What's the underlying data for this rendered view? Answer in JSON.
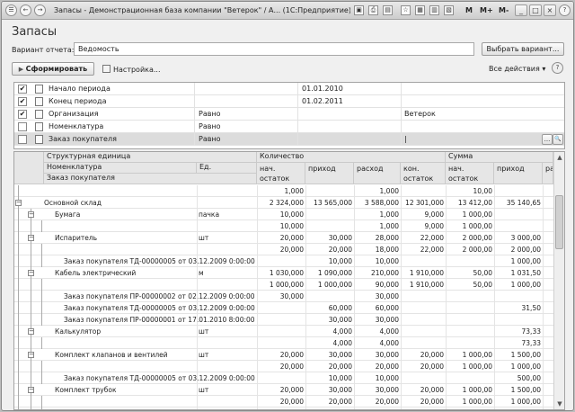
{
  "window": {
    "title": "Запасы - Демонстрационная база компании \"Ветерок\" / А...",
    "app": "(1С:Предприятие)",
    "m_labels": [
      "M",
      "M+",
      "M-"
    ],
    "controls": [
      "_",
      "□",
      "×"
    ],
    "star": "☆",
    "question": "?"
  },
  "heading": "Запасы",
  "variant": {
    "label": "Вариант отчета:",
    "value": "Ведомость",
    "button": "Выбрать вариант..."
  },
  "toolbar": {
    "form_button": "Сформировать",
    "settings_button": "Настройка...",
    "all_actions": "Все действия ▾",
    "help": "?"
  },
  "filters": [
    {
      "checked": true,
      "name": "Начало периода",
      "compare": "",
      "value": "01.01.2010",
      "value2": ""
    },
    {
      "checked": true,
      "name": "Конец периода",
      "compare": "",
      "value": "01.02.2011",
      "value2": ""
    },
    {
      "checked": true,
      "name": "Организация",
      "compare": "Равно",
      "value": "",
      "value2": "Ветерок"
    },
    {
      "checked": false,
      "name": "Номенклатура",
      "compare": "Равно",
      "value": "",
      "value2": ""
    },
    {
      "checked": false,
      "name": "Заказ покупателя",
      "compare": "Равно",
      "value": "",
      "value2": "|"
    }
  ],
  "filter_buttons": [
    "...",
    "🔍"
  ],
  "grid": {
    "headers": {
      "structure": "Структурная единица",
      "nomenclature": "Номенклатура",
      "order": "Заказ покупателя",
      "unit": "Ед.",
      "quantity": "Количество",
      "sum": "Сумма",
      "cols": [
        "нач. остаток",
        "приход",
        "расход",
        "кон. остаток",
        "нач. остаток",
        "приход",
        "ра"
      ]
    },
    "rows": [
      {
        "level": 0,
        "name": "",
        "unit": "",
        "vals": [
          "1,000",
          "",
          "1,000",
          "",
          "10,00",
          "",
          ""
        ]
      },
      {
        "level": 0,
        "name": "Основной склад",
        "unit": "",
        "vals": [
          "2 324,000",
          "13 565,000",
          "3 588,000",
          "12 301,000",
          "13 412,00",
          "35 140,65",
          ""
        ]
      },
      {
        "level": 1,
        "name": "Бумага",
        "unit": "пачка",
        "vals": [
          "10,000",
          "",
          "1,000",
          "9,000",
          "1 000,00",
          "",
          ""
        ]
      },
      {
        "level": 2,
        "name": "",
        "unit": "",
        "vals": [
          "10,000",
          "",
          "1,000",
          "9,000",
          "1 000,00",
          "",
          ""
        ]
      },
      {
        "level": 1,
        "name": "Испаритель",
        "unit": "шт",
        "vals": [
          "20,000",
          "30,000",
          "28,000",
          "22,000",
          "2 000,00",
          "3 000,00",
          ""
        ]
      },
      {
        "level": 2,
        "name": "",
        "unit": "",
        "vals": [
          "20,000",
          "20,000",
          "18,000",
          "22,000",
          "2 000,00",
          "2 000,00",
          ""
        ]
      },
      {
        "level": 3,
        "name": "Заказ покупателя ТД-00000005 от 03.12.2009 0:00:00",
        "unit": "",
        "vals": [
          "",
          "10,000",
          "10,000",
          "",
          "",
          "1 000,00",
          ""
        ]
      },
      {
        "level": 1,
        "name": "Кабель электрический",
        "unit": "м",
        "vals": [
          "1 030,000",
          "1 090,000",
          "210,000",
          "1 910,000",
          "50,00",
          "1 031,50",
          ""
        ]
      },
      {
        "level": 2,
        "name": "",
        "unit": "",
        "vals": [
          "1 000,000",
          "1 000,000",
          "90,000",
          "1 910,000",
          "50,00",
          "1 000,00",
          ""
        ]
      },
      {
        "level": 3,
        "name": "Заказ покупателя ПР-00000002 от 02.12.2009 0:00:00",
        "unit": "",
        "vals": [
          "30,000",
          "",
          "30,000",
          "",
          "",
          "",
          ""
        ]
      },
      {
        "level": 3,
        "name": "Заказ покупателя ТД-00000005 от 03.12.2009 0:00:00",
        "unit": "",
        "vals": [
          "",
          "60,000",
          "60,000",
          "",
          "",
          "31,50",
          ""
        ]
      },
      {
        "level": 3,
        "name": "Заказ покупателя ПР-00000001 от 17.01.2010 8:00:00",
        "unit": "",
        "vals": [
          "",
          "30,000",
          "30,000",
          "",
          "",
          "",
          ""
        ]
      },
      {
        "level": 1,
        "name": "Калькулятор",
        "unit": "шт",
        "vals": [
          "",
          "4,000",
          "4,000",
          "",
          "",
          "73,33",
          ""
        ]
      },
      {
        "level": 2,
        "name": "",
        "unit": "",
        "vals": [
          "",
          "4,000",
          "4,000",
          "",
          "",
          "73,33",
          ""
        ]
      },
      {
        "level": 1,
        "name": "Комплект клапанов и вентилей",
        "unit": "шт",
        "vals": [
          "20,000",
          "30,000",
          "30,000",
          "20,000",
          "1 000,00",
          "1 500,00",
          ""
        ]
      },
      {
        "level": 2,
        "name": "",
        "unit": "",
        "vals": [
          "20,000",
          "20,000",
          "20,000",
          "20,000",
          "1 000,00",
          "1 000,00",
          ""
        ]
      },
      {
        "level": 3,
        "name": "Заказ покупателя ТД-00000005 от 03.12.2009 0:00:00",
        "unit": "",
        "vals": [
          "",
          "10,000",
          "10,000",
          "",
          "",
          "500,00",
          ""
        ]
      },
      {
        "level": 1,
        "name": "Комплект трубок",
        "unit": "шт",
        "vals": [
          "20,000",
          "30,000",
          "30,000",
          "20,000",
          "1 000,00",
          "1 500,00",
          ""
        ]
      },
      {
        "level": 2,
        "name": "",
        "unit": "",
        "vals": [
          "20,000",
          "20,000",
          "20,000",
          "20,000",
          "1 000,00",
          "1 000,00",
          ""
        ]
      },
      {
        "level": 3,
        "name": "Заказ покупателя ТД-00000005 от 03.12.2009 0:00:00",
        "unit": "",
        "vals": [
          "",
          "10,000",
          "10,000",
          "",
          "",
          "500,00",
          ""
        ]
      }
    ]
  }
}
